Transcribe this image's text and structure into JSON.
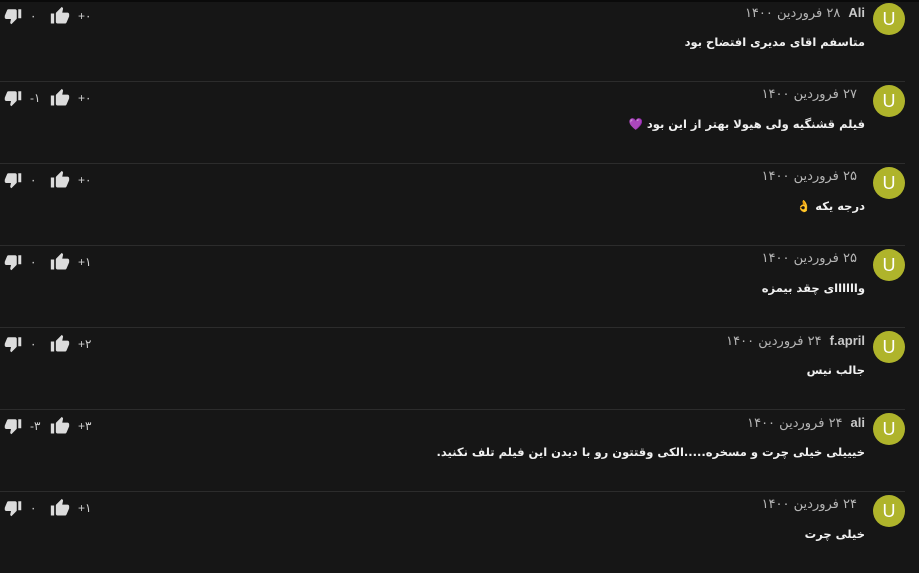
{
  "comments": [
    {
      "avatar": "U",
      "author": "Ali",
      "date": "۲۸ فروردین ۱۴۰۰",
      "text": "متاسفم اقای مدیری افتضاح بود",
      "likes": "+۰",
      "dislikes": "۰"
    },
    {
      "avatar": "U",
      "author": "",
      "date": "۲۷ فروردین ۱۴۰۰",
      "text": "فیلم قشنگیه ولی هیولا بهتر از این بود 💜",
      "likes": "+۰",
      "dislikes": "-۱"
    },
    {
      "avatar": "U",
      "author": "",
      "date": "۲۵ فروردین ۱۴۰۰",
      "text": "درجه یکه 👌",
      "likes": "+۰",
      "dislikes": "۰"
    },
    {
      "avatar": "U",
      "author": "",
      "date": "۲۵ فروردین ۱۴۰۰",
      "text": "واااااای چقد بیمزه",
      "likes": "+۱",
      "dislikes": "۰"
    },
    {
      "avatar": "U",
      "author": "f.april",
      "date": "۲۴ فروردین ۱۴۰۰",
      "text": "جالب نیس",
      "likes": "+۲",
      "dislikes": "۰"
    },
    {
      "avatar": "U",
      "author": "ali",
      "date": "۲۴ فروردین ۱۴۰۰",
      "text": "خیییلی خیلی چرت و مسخره.....الکی وقتتون رو با دیدن این فیلم تلف نکنید.",
      "likes": "+۳",
      "dislikes": "-۳"
    },
    {
      "avatar": "U",
      "author": "",
      "date": "۲۴ فروردین ۱۴۰۰",
      "text": "خیلی چرت",
      "likes": "+۱",
      "dislikes": "۰"
    }
  ],
  "colors": {
    "background": "#161616",
    "avatar": "#afb42b",
    "divider": "#2c2c2c"
  },
  "icons": {
    "like": "thumbs-up-icon",
    "dislike": "thumbs-down-icon"
  }
}
